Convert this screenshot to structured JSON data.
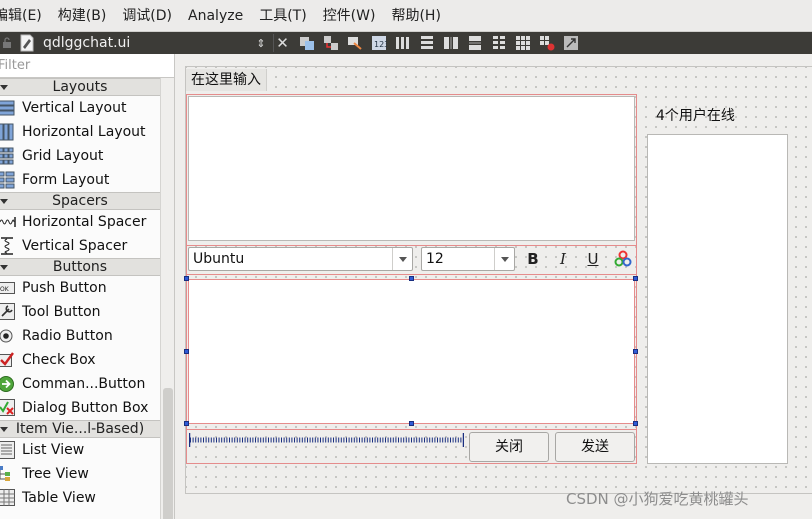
{
  "menubar": {
    "items": [
      "编辑(E)",
      "构建(B)",
      "调试(D)",
      "Analyze",
      "工具(T)",
      "控件(W)",
      "帮助(H)"
    ]
  },
  "document": {
    "filename": "qdlggchat.ui",
    "arrows_glyph": "⇕",
    "close_glyph": "✕"
  },
  "widgetbox": {
    "filter_placeholder": "Filter",
    "categories": {
      "layouts": "Layouts",
      "spacers": "Spacers",
      "buttons": "Buttons",
      "item_views": "Item Vie...l-Based)"
    },
    "items": {
      "vertical_layout": "Vertical Layout",
      "horizontal_layout": "Horizontal Layout",
      "grid_layout": "Grid Layout",
      "form_layout": "Form Layout",
      "horizontal_spacer": "Horizontal Spacer",
      "vertical_spacer": "Vertical Spacer",
      "push_button": "Push Button",
      "tool_button": "Tool Button",
      "radio_button": "Radio Button",
      "check_box": "Check Box",
      "command_button": "Comman...Button",
      "dialog_button_box": "Dialog Button Box",
      "list_view": "List View",
      "tree_view": "Tree View",
      "table_view": "Table View"
    }
  },
  "form": {
    "tab_title": "在这里输入",
    "font_combo": "Ubuntu",
    "size_combo": "12",
    "bold": "B",
    "italic": "I",
    "underline": "U",
    "close_button": "关闭",
    "send_button": "发送",
    "online_users": "4个用户在线"
  },
  "watermark": "CSDN @小狗爱吃黄桃罐头",
  "colors": {
    "layout_border": "#e58c8c",
    "handle": "#2f5bd6",
    "doc_toolbar": "#3c3b37"
  }
}
